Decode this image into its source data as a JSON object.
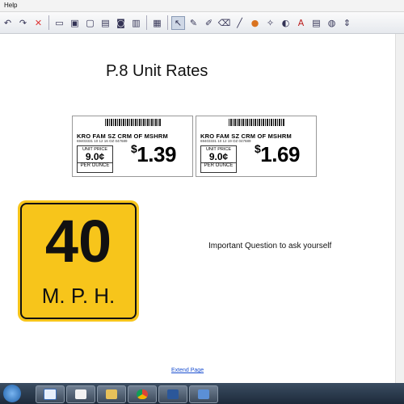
{
  "menu": {
    "help": "Help"
  },
  "toolbar": {
    "icons": [
      "undo-icon",
      "redo-icon",
      "delete-icon",
      "screen-capture-icon",
      "display-icon",
      "display-area-icon",
      "window-capture-icon",
      "camera-icon",
      "whiteboard-icon",
      "table-icon",
      "select-arrow-icon",
      "pen-icon",
      "highlighter-icon",
      "eraser-icon",
      "line-icon",
      "shape-icon",
      "magic-pen-icon",
      "fill-icon",
      "text-icon",
      "format-icon",
      "properties-icon",
      "more-icon"
    ]
  },
  "page": {
    "title": "P.8 Unit Rates",
    "labels": [
      {
        "heading": "KRO  FAM  SZ  CRM  OF  MSHRM",
        "subline": "69403331  10  12        16 OZ  047689",
        "unit_caption": "UNIT PRICE",
        "unit_value": "9.0¢",
        "unit_footer": "PER OUNCE",
        "price_symbol": "$",
        "price": "1.39"
      },
      {
        "heading": "KRO  FAM  SZ  CRM  OF  MSHRM",
        "subline": "69403331  10  12        19 OZ  047689",
        "unit_caption": "UNIT PRICE",
        "unit_value": "9.0¢",
        "unit_footer": "PER OUNCE",
        "price_symbol": "$",
        "price": "1.69"
      }
    ],
    "sign": {
      "speed": "40",
      "unit": "M. P. H.",
      "color": "#f7c51b"
    },
    "question": "Important Question to ask yourself",
    "extend_link": "Extend Page"
  },
  "taskbar": {
    "apps": [
      "file-explorer-icon",
      "notepad-icon",
      "windows-explorer-icon",
      "chrome-icon",
      "word-icon",
      "smart-notebook-icon"
    ]
  }
}
